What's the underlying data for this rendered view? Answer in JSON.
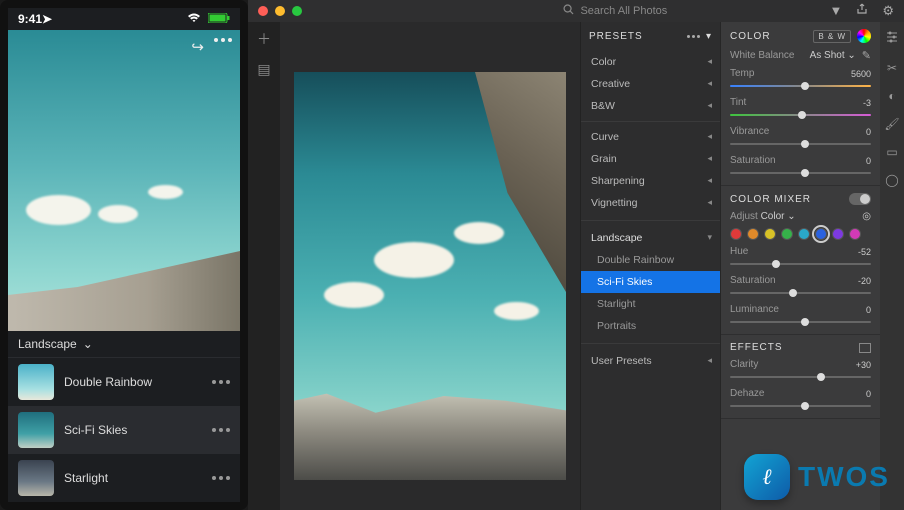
{
  "mobile": {
    "time": "9:41",
    "group_label": "Landscape",
    "presets": [
      {
        "label": "Double Rainbow"
      },
      {
        "label": "Sci-Fi Skies"
      },
      {
        "label": "Starlight"
      }
    ]
  },
  "desktop": {
    "search_placeholder": "Search All Photos",
    "presets": {
      "title": "PRESETS",
      "top_categories": [
        "Color",
        "Creative",
        "B&W"
      ],
      "mid_categories": [
        "Curve",
        "Grain",
        "Sharpening",
        "Vignetting"
      ],
      "expanded": {
        "label": "Landscape",
        "items": [
          "Double Rainbow",
          "Sci-Fi Skies",
          "Starlight",
          "Portraits"
        ],
        "active_index": 1
      },
      "user_label": "User Presets"
    }
  },
  "color": {
    "title": "COLOR",
    "bw_label": "B & W",
    "wb_label": "White Balance",
    "wb_value": "As Shot",
    "temp": {
      "label": "Temp",
      "value": "5600",
      "pos": 50
    },
    "tint": {
      "label": "Tint",
      "value": "-3",
      "pos": 48
    },
    "vibrance": {
      "label": "Vibrance",
      "value": "0",
      "pos": 50
    },
    "saturation": {
      "label": "Saturation",
      "value": "0",
      "pos": 50
    }
  },
  "mixer": {
    "title": "COLOR MIXER",
    "adjust_label": "Adjust",
    "adjust_value": "Color",
    "swatches": [
      "#e03a3a",
      "#e08a2a",
      "#d8c227",
      "#36b24a",
      "#2aa8c9",
      "#2a62e0",
      "#7d3ae0",
      "#d23ab6"
    ],
    "selected_swatch": 5,
    "hue": {
      "label": "Hue",
      "value": "-52",
      "pos": 30
    },
    "sat": {
      "label": "Saturation",
      "value": "-20",
      "pos": 42
    },
    "lum": {
      "label": "Luminance",
      "value": "0",
      "pos": 50
    }
  },
  "effects": {
    "title": "EFFECTS",
    "clarity": {
      "label": "Clarity",
      "value": "+30",
      "pos": 62
    },
    "dehaze": {
      "label": "Dehaze",
      "value": "0",
      "pos": 50
    }
  },
  "watermark": {
    "text": "TWOS"
  }
}
